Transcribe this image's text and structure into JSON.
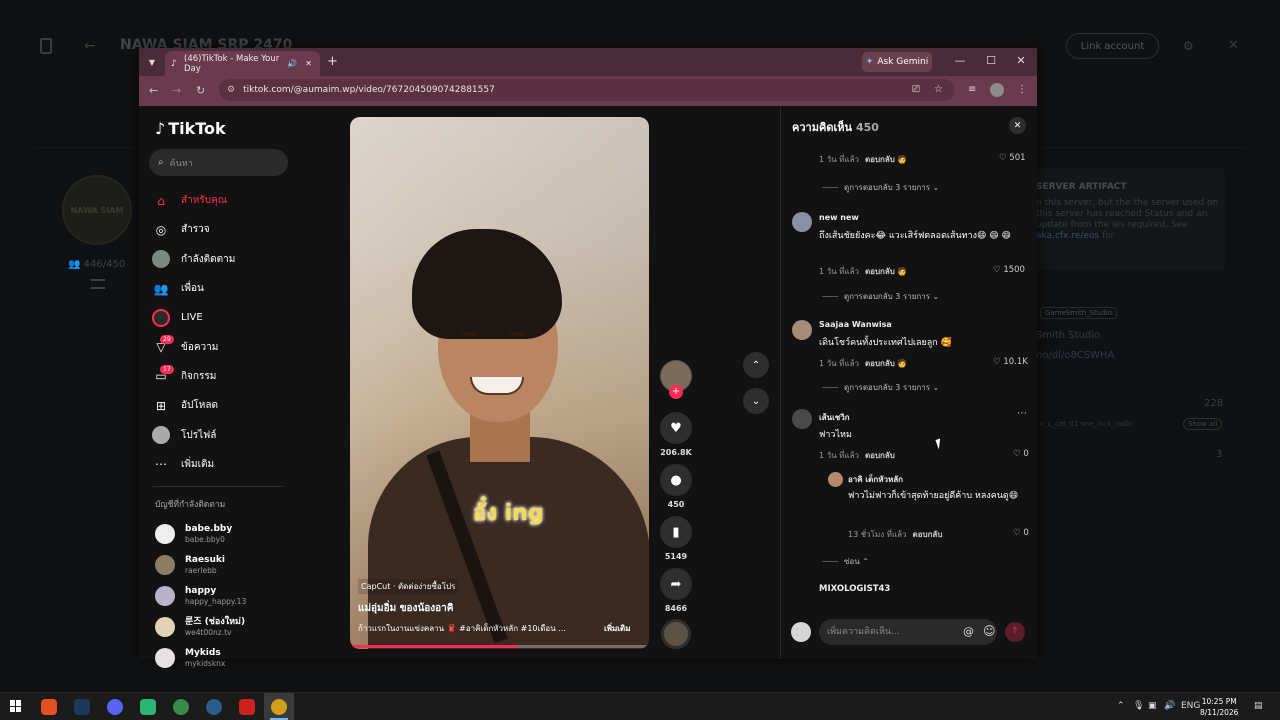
{
  "background": {
    "title": "NAWA SIAM SRP 2470",
    "link_account": "Link account",
    "members": "446/450",
    "avatar_text": "NAWA SIAM",
    "card_heading": "SERVER ARTIFACT",
    "card_text": "n this server, but the the server used on this server has reached Status and an update from the ies required. See",
    "card_link": "aka.cfx.re/eos",
    "card_tail": "for",
    "tag": "GameSmith_Studio",
    "smith": "Smith Studio",
    "url": "no/dl/o8CSWHA",
    "count1": "228",
    "chips": "x_c_cat_01   one_lock_radio",
    "show_all": "Show all",
    "count2": "3"
  },
  "browser": {
    "tab_title": "(46)TikTok - Make Your Day",
    "ask_gemini": "Ask Gemini",
    "url": "tiktok.com/@aumaim.wp/video/7672045090742881557"
  },
  "sidebar": {
    "logo": "TikTok",
    "search_placeholder": "ค้นหา",
    "items": [
      {
        "label": "สำหรับคุณ",
        "icon": "home-icon"
      },
      {
        "label": "สำรวจ",
        "icon": "compass-icon"
      },
      {
        "label": "กำลังติดตาม",
        "icon": "following-avatar"
      },
      {
        "label": "เพื่อน",
        "icon": "friends-icon"
      },
      {
        "label": "LIVE",
        "icon": "live-icon"
      },
      {
        "label": "ข้อความ",
        "icon": "message-icon",
        "badge": "29"
      },
      {
        "label": "กิจกรรม",
        "icon": "activity-icon",
        "badge": "17"
      },
      {
        "label": "อัปโหลด",
        "icon": "upload-icon"
      },
      {
        "label": "โปรไฟล์",
        "icon": "profile-avatar"
      },
      {
        "label": "เพิ่มเติม",
        "icon": "more-icon"
      }
    ],
    "following_heading": "บัญชีที่กำลังติดตาม",
    "following": [
      {
        "name": "babe.bby",
        "user": "babe.bby0"
      },
      {
        "name": "Raesuki",
        "user": "raerlebb"
      },
      {
        "name": "happy",
        "user": "happy_happy.13"
      },
      {
        "name": "룬즈 (ช่องใหม่)",
        "user": "we4t00nz.tv"
      },
      {
        "name": "Mykids",
        "user": "mykidsknx"
      }
    ]
  },
  "video": {
    "sticker_text": "อั๋ง ing",
    "capcut": "CapCut · ตัดต่อง่ายซื้อโปร",
    "caption": "แม่อุ่มอิ่ม ของน้องอาคิ",
    "description": "ก้าวแรกในงานแข่งคลาน 🧣 #อาคิเด็กหัวหลัก #10เดือน ...",
    "see_more": "เพิ่มเติม",
    "progress": 0.56,
    "likes": "206.8K",
    "comments": "450",
    "saves": "5149",
    "shares": "8466"
  },
  "comments_panel": {
    "title": "ความคิดเห็น",
    "count": "450",
    "input_placeholder": "เพิ่มความคิดเห็น...",
    "top_meta": {
      "time": "1 วัน ที่แล้ว",
      "reply": "ตอบกลับ",
      "likes": "501"
    },
    "view_replies_1": "ดูการตอบกลับ 3 รายการ",
    "c1": {
      "name": "new new",
      "text": "ถึงเส้นชัยยังคะ😂 แวะเสิร์ฟตลอดเส้นทาง😄 😄 😄",
      "time": "1 วัน ที่แล้ว",
      "reply": "ตอบกลับ",
      "likes": "1500",
      "view_replies": "ดูการตอบกลับ 3 รายการ"
    },
    "c2": {
      "name": "Saajaa Wanwisa",
      "text": "เดินโชว์คนทั้งประเทศไปเลยลูก 🥰",
      "time": "1 วัน ที่แล้ว",
      "reply": "ตอบกลับ",
      "likes": "10.1K",
      "view_replies": "ดูการตอบกลับ 3 รายการ"
    },
    "c3": {
      "name": "เส้นเชวิก",
      "text": "ฟาวไหม",
      "time": "1 วัน ที่แล้ว",
      "reply": "ตอบกลับ",
      "likes": "0"
    },
    "r1": {
      "name": "อาคิ เด็กหัวหลัก",
      "text": "ฟาวไม่ฟาวก็เข้าสุดท้ายอยู่ดีค้าบ หลงคนดู😄",
      "time": "13 ชั่วโมง ที่แล้ว",
      "reply": "ตอบกลับ",
      "likes": "0"
    },
    "hide": "ซ่อน",
    "c4": {
      "name": "MIXOLOGIST43"
    }
  },
  "taskbar": {
    "lang": "ENG",
    "time": "10:25 PM",
    "date": "8/11/2026"
  },
  "colors": {
    "accent": "#fe2c55",
    "tab_bar": "#492c38",
    "toolbar": "#6a3a4d"
  }
}
